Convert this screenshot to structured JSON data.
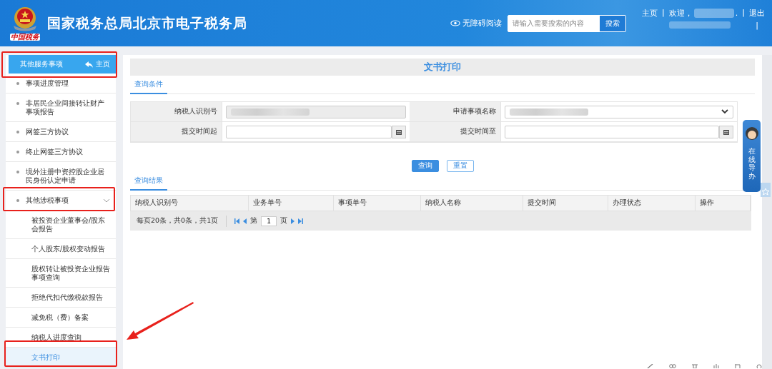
{
  "header": {
    "logo_text": "中国税务",
    "site_title": "国家税务总局北京市电子税务局",
    "accessibility": "无障碍阅读",
    "search": {
      "placeholder": "请输入需要搜索的内容",
      "button": "搜索"
    },
    "home": "主页",
    "separator": "|",
    "welcome": "欢迎，",
    "welcome_tail": ".",
    "logout": "退出"
  },
  "sidebar": {
    "title": "其他服务事项",
    "home_link": "主页",
    "items": [
      {
        "label": "事项进度管理",
        "kind": "link",
        "selected": false
      },
      {
        "label": "非居民企业间接转让财产事项报告",
        "kind": "link",
        "selected": false
      },
      {
        "label": "网签三方协议",
        "kind": "link",
        "selected": false
      },
      {
        "label": "终止网签三方协议",
        "kind": "link",
        "selected": false
      },
      {
        "label": "境外注册中资控股企业居民身份认定申请",
        "kind": "link",
        "selected": false
      },
      {
        "label": "其他涉税事项",
        "kind": "group",
        "selected": false,
        "expanded": true,
        "children": [
          {
            "label": "被投资企业董事会/股东会报告",
            "selected": false
          },
          {
            "label": "个人股东/股权变动报告",
            "selected": false
          },
          {
            "label": "股权转让被投资企业报告事项查询",
            "selected": false
          },
          {
            "label": "拒绝代扣代缴税款报告",
            "selected": false
          },
          {
            "label": "减免税（费）备案",
            "selected": false
          },
          {
            "label": "纳税人进度查询",
            "selected": false
          },
          {
            "label": "文书打印",
            "selected": true
          }
        ]
      }
    ]
  },
  "page_title": "文书打印",
  "query_tab": "查询条件",
  "form": [
    {
      "label": "纳税人识别号",
      "kind": "readonly"
    },
    {
      "label": "申请事项名称",
      "kind": "select"
    },
    {
      "label": "提交时间起",
      "kind": "date"
    },
    {
      "label": "提交时间至",
      "kind": "date"
    }
  ],
  "buttons": [
    {
      "label": "查询",
      "kind": "primary"
    },
    {
      "label": "重置",
      "kind": "secondary"
    }
  ],
  "results_tab": "查询结果",
  "table": {
    "columns": [
      "纳税人识别号",
      "业务单号",
      "事项单号",
      "纳税人名称",
      "提交时间",
      "办理状态",
      "操作"
    ]
  },
  "pagination": {
    "summary": "每页20条，共0条，共1页",
    "before": "第",
    "page": "1",
    "after": "页"
  },
  "guide_widget": {
    "label": "在线导办"
  }
}
